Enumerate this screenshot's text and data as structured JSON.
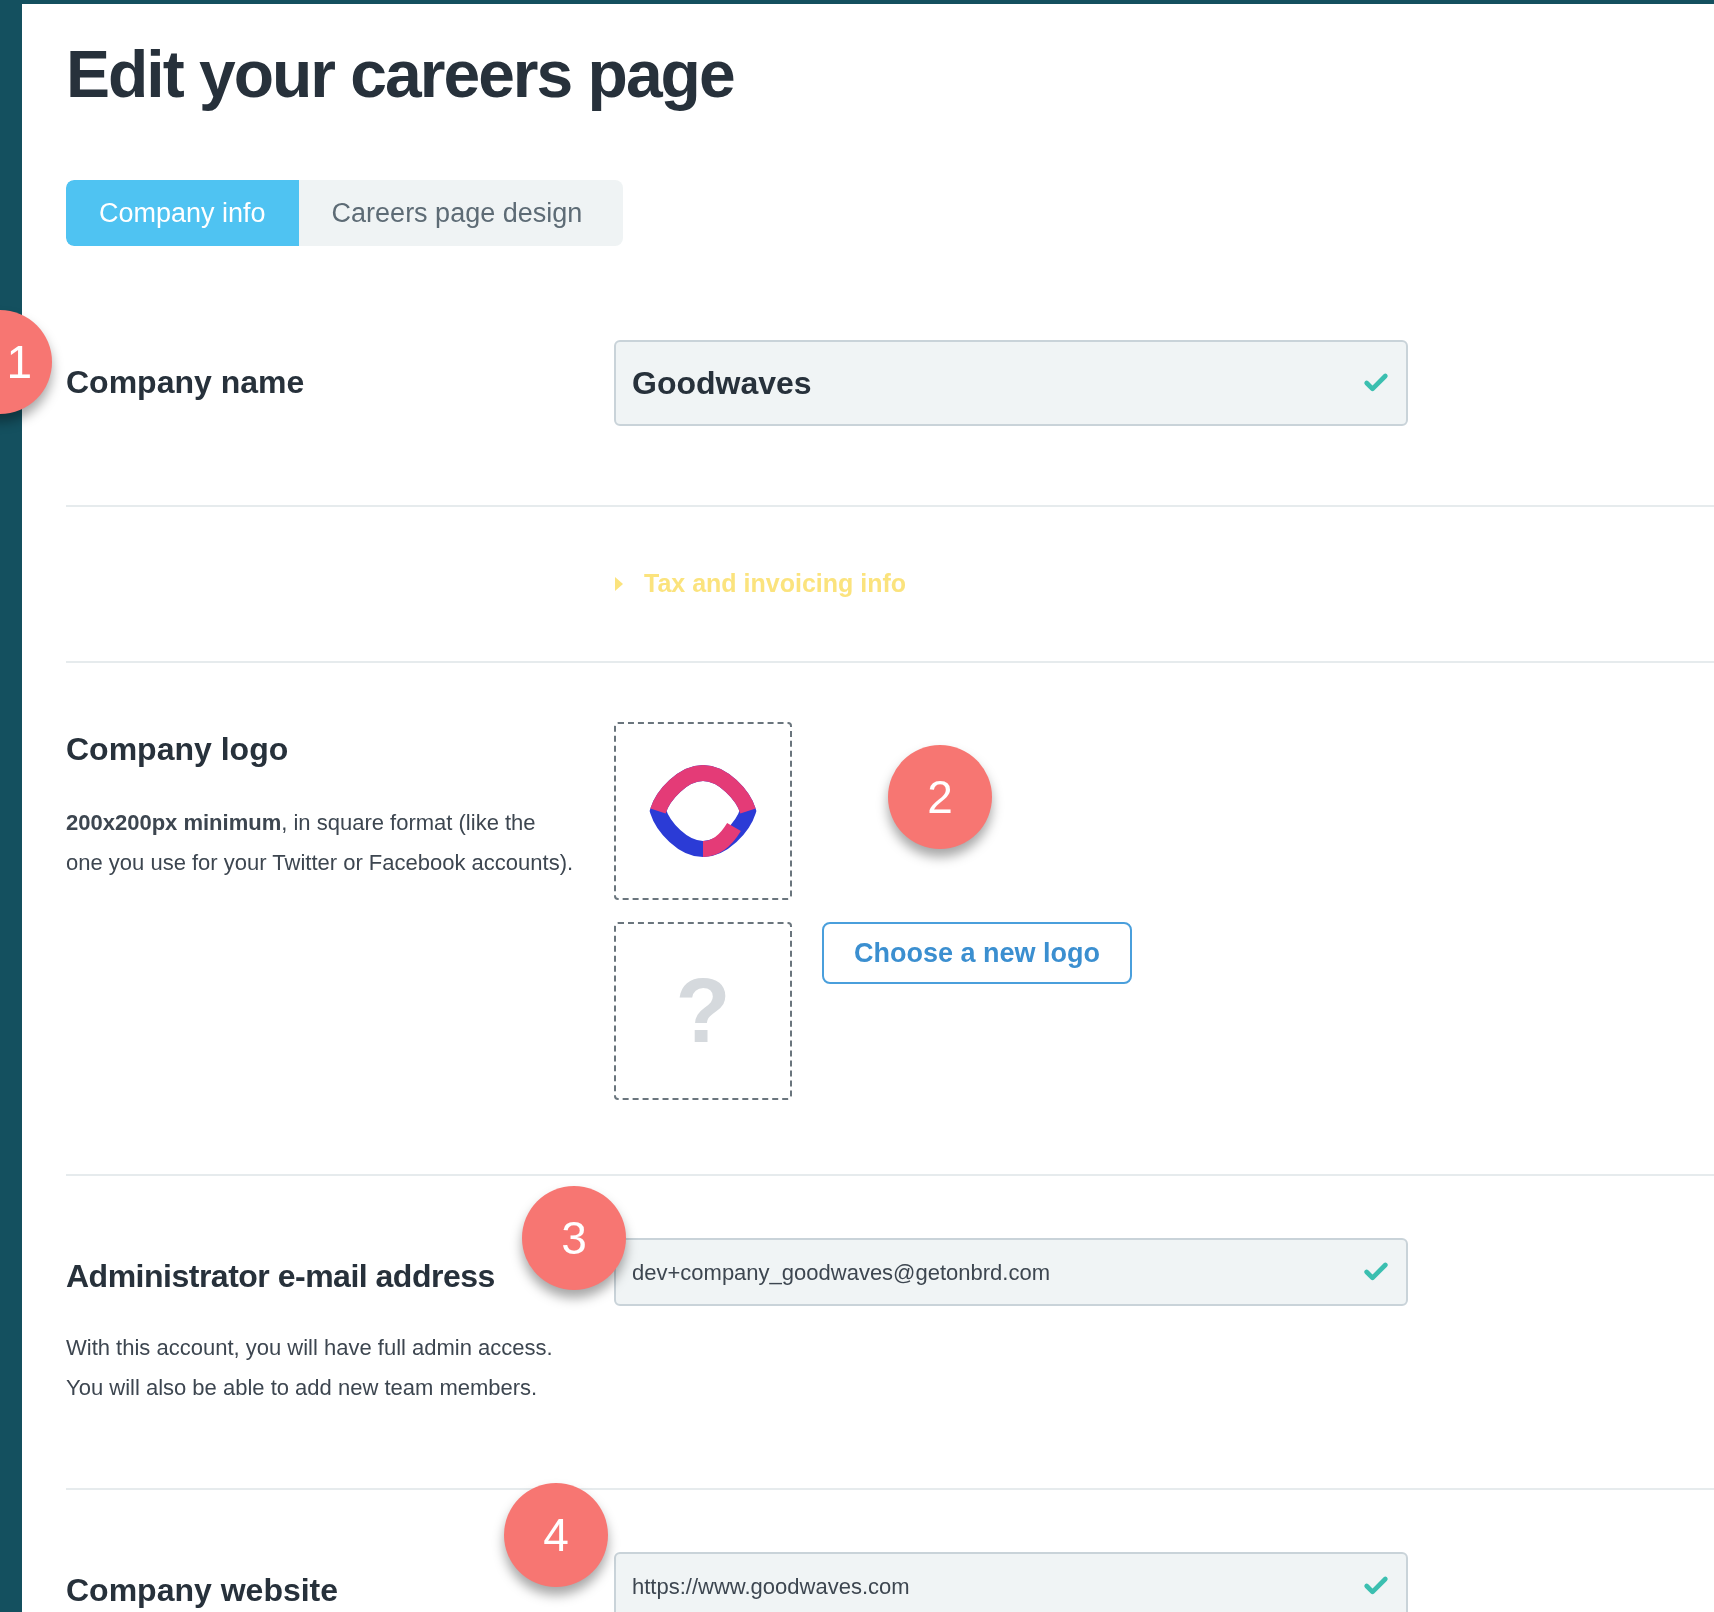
{
  "title": "Edit your careers page",
  "tabs": [
    {
      "label": "Company info",
      "selected": true
    },
    {
      "label": "Careers page design",
      "selected": false
    }
  ],
  "company_name": {
    "label": "Company name",
    "value": "Goodwaves",
    "valid": true
  },
  "tax_link": {
    "label": "Tax and invoicing info",
    "expanded": false
  },
  "company_logo": {
    "label": "Company logo",
    "hint": "**200x200px minimum**, in square format (like the one you use for your Twitter or Facebook accounts).",
    "button": "Choose a new logo",
    "placeholder_mark": "?"
  },
  "admin_email": {
    "label": "Administrator e-mail address",
    "value": "dev+company_goodwaves@getonbrd.com",
    "valid": true,
    "hint": "With this account, you will have full admin access. You will also be able to add new team members."
  },
  "company_website": {
    "label": "Company website",
    "value": "https://www.goodwaves.com",
    "valid": true
  },
  "annotations": [
    "1",
    "2",
    "3",
    "4"
  ]
}
